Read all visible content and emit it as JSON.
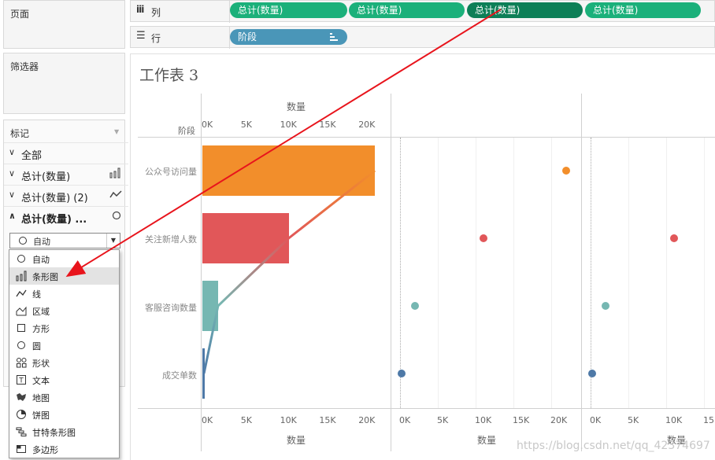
{
  "left": {
    "pages_title": "页面",
    "filters_title": "筛选器",
    "marks_title": "标记",
    "marks_rows": [
      {
        "label": "全部",
        "icon": "none"
      },
      {
        "label": "总计(数量)",
        "icon": "bar-chart-icon"
      },
      {
        "label": "总计(数量) (2)",
        "icon": "line-chart-icon"
      },
      {
        "label": "总计(数量) ...",
        "icon": "circle-icon"
      }
    ],
    "mark_type_selected": "自动",
    "mark_type_options": [
      "自动",
      "条形图",
      "线",
      "区域",
      "方形",
      "圆",
      "形状",
      "文本",
      "地图",
      "饼图",
      "甘特条形图",
      "多边形"
    ]
  },
  "shelves": {
    "columns_label": "列",
    "rows_label": "行",
    "column_pills": [
      "总计(数量)",
      "总计(数量)",
      "总计(数量)",
      "总计(数量)"
    ],
    "row_pill": "阶段"
  },
  "sheet": {
    "title": "工作表 3",
    "row_header": "阶段",
    "top_axis_title": "数量",
    "bottom_axis_titles": [
      "数量",
      "数量",
      "数量"
    ],
    "ticks_bar": [
      "0K",
      "5K",
      "10K",
      "15K",
      "20K"
    ],
    "ticks_mid": [
      "0K",
      "5K",
      "10K",
      "15K",
      "20K"
    ],
    "ticks_right": [
      "0K",
      "5K",
      "10K",
      "15K",
      "20K"
    ]
  },
  "chart_data": {
    "type": "bar",
    "categories": [
      "公众号访问量",
      "关注新增人数",
      "客服咨询数量",
      "成交单数"
    ],
    "series": [
      {
        "values": [
          22000,
          11000,
          2000,
          200
        ]
      }
    ],
    "colors": [
      "#f28e2b",
      "#e15759",
      "#76b7b2",
      "#4e79a7"
    ],
    "xlim": [
      0,
      25000
    ]
  },
  "watermark": "https://blog.csdn.net/qq_42374697"
}
